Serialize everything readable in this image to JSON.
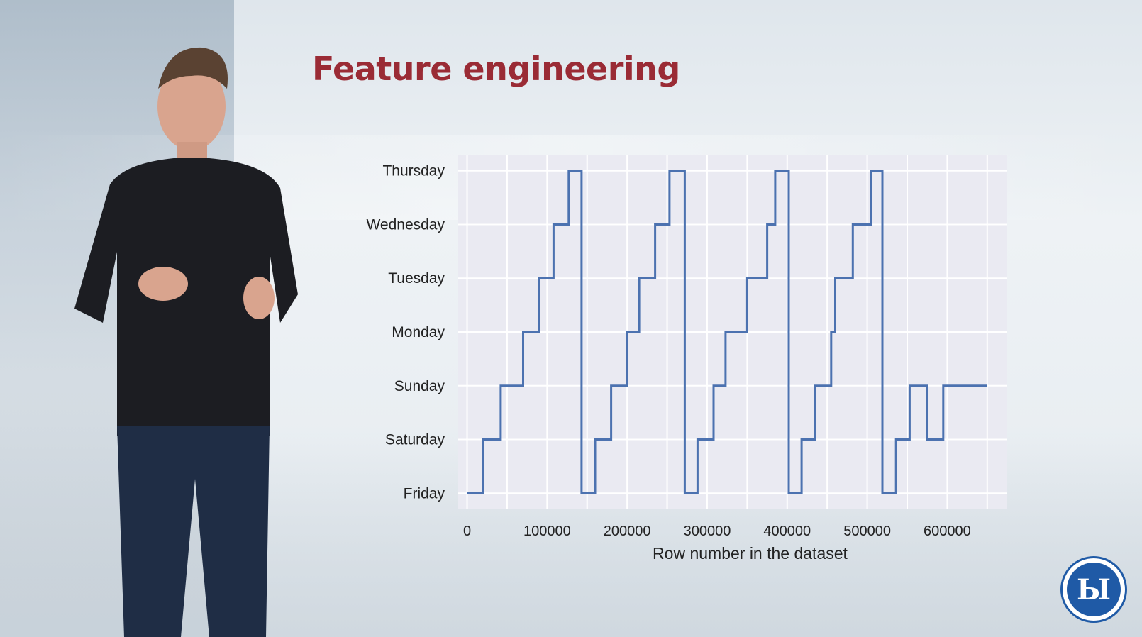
{
  "slide": {
    "title": "Feature engineering",
    "title_color": "#9a2b35",
    "logo_icon": "hse-university-logo"
  },
  "chart_data": {
    "type": "line",
    "title": "",
    "xlabel": "Row number in the dataset",
    "ylabel": "",
    "categories": [
      "Friday",
      "Saturday",
      "Sunday",
      "Monday",
      "Tuesday",
      "Wednesday",
      "Thursday"
    ],
    "xlim": [
      -12000,
      675000
    ],
    "ylim": [
      -0.3,
      6.3
    ],
    "xticks": [
      0,
      100000,
      200000,
      300000,
      400000,
      500000,
      600000
    ],
    "grid": true,
    "line_color": "#4c72b0",
    "background_color": "#eaeaf2",
    "series": [
      {
        "x": [
          0,
          20000,
          20000,
          42000,
          42000,
          70000,
          70000,
          90000,
          90000,
          108000,
          108000,
          127000,
          127000,
          143000,
          143000,
          160000,
          160000,
          180000,
          180000,
          200000,
          200000,
          215000,
          215000,
          235000,
          235000,
          253000,
          253000,
          272000,
          272000,
          288000,
          288000,
          308000,
          308000,
          323000,
          323000,
          350000,
          350000,
          375000,
          375000,
          385000,
          385000,
          402000,
          402000,
          418000,
          418000,
          435000,
          435000,
          455000,
          455000,
          460000,
          460000,
          482000,
          482000,
          505000,
          505000,
          519000,
          519000,
          536000,
          536000,
          553000,
          553000,
          570000,
          570000,
          575000,
          575000,
          595000,
          595000,
          615000,
          615000,
          623000,
          623000,
          650000
        ],
        "y": [
          0,
          0,
          1,
          1,
          2,
          2,
          3,
          3,
          4,
          4,
          5,
          5,
          6,
          6,
          0,
          0,
          1,
          1,
          2,
          2,
          3,
          3,
          4,
          4,
          5,
          5,
          6,
          6,
          0,
          0,
          1,
          1,
          2,
          2,
          3,
          3,
          4,
          4,
          5,
          5,
          6,
          6,
          0,
          0,
          1,
          1,
          2,
          2,
          3,
          3,
          4,
          4,
          5,
          5,
          6,
          6,
          0,
          0,
          1,
          1,
          2,
          2,
          2,
          2,
          1,
          1,
          2,
          2,
          2,
          2,
          2,
          2
        ]
      }
    ]
  }
}
